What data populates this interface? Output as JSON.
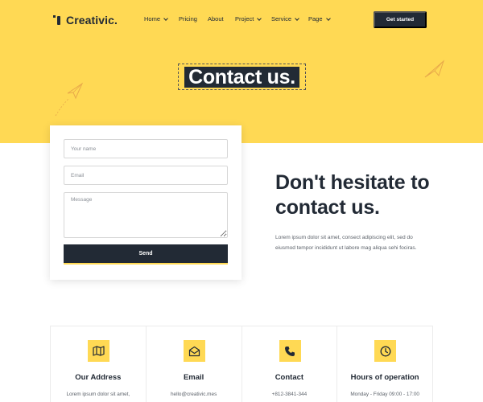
{
  "brand": {
    "name": "Creativic."
  },
  "nav": {
    "items": [
      {
        "label": "Home",
        "has_dropdown": true
      },
      {
        "label": "Pricing",
        "has_dropdown": false
      },
      {
        "label": "About",
        "has_dropdown": false
      },
      {
        "label": "Project",
        "has_dropdown": true
      },
      {
        "label": "Service",
        "has_dropdown": true
      },
      {
        "label": "Page",
        "has_dropdown": true
      }
    ],
    "cta_label": "Get started"
  },
  "hero": {
    "title": "Contact us."
  },
  "form": {
    "name_placeholder": "Your name",
    "email_placeholder": "Email",
    "message_placeholder": "Message",
    "name_value": "",
    "email_value": "",
    "message_value": "",
    "send_label": "Send"
  },
  "intro": {
    "heading": "Don't hesitate to contact us.",
    "paragraph": "Lorem ipsum dolor sit amet, consect adipiscing elit, sed do eiusmod tempor incididunt ut labore mag aliqua sehi fociras."
  },
  "info_cards": [
    {
      "icon": "map-icon",
      "title": "Our Address",
      "text": "Lorem ipsum dolor sit amet,"
    },
    {
      "icon": "envelope-icon",
      "title": "Email",
      "text": "hello@creativic.mes"
    },
    {
      "icon": "phone-icon",
      "title": "Contact",
      "text": "+812-3841-344"
    },
    {
      "icon": "clock-icon",
      "title": "Hours of operation",
      "text": "Monday - Friday 09:00 - 17:00"
    }
  ],
  "colors": {
    "accent": "#ffd954",
    "dark": "#222a35",
    "text_muted": "#5c626a",
    "white": "#ffffff"
  }
}
